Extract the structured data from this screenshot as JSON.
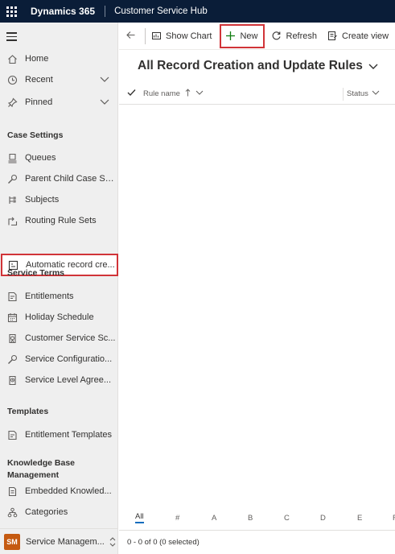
{
  "topbar": {
    "app_name": "Dynamics 365",
    "module_name": "Customer Service Hub"
  },
  "sidebar": {
    "top_items": [
      {
        "label": "Home",
        "icon": "home-icon"
      },
      {
        "label": "Recent",
        "icon": "clock-icon",
        "expandable": true
      },
      {
        "label": "Pinned",
        "icon": "pin-icon",
        "expandable": true
      }
    ],
    "sections": [
      {
        "title": "Case Settings",
        "items": [
          {
            "label": "Queues",
            "icon": "queue-icon"
          },
          {
            "label": "Parent Child Case Set...",
            "icon": "wrench-icon"
          },
          {
            "label": "Subjects",
            "icon": "subjects-icon"
          },
          {
            "label": "Routing Rule Sets",
            "icon": "routing-icon"
          },
          {
            "label": "Automatic record cre...",
            "icon": "record-creation-icon",
            "selected": true
          }
        ]
      },
      {
        "title": "Service Terms",
        "items": [
          {
            "label": "Entitlements",
            "icon": "entitlement-icon"
          },
          {
            "label": "Holiday Schedule",
            "icon": "calendar-icon"
          },
          {
            "label": "Customer Service Sc...",
            "icon": "schedule-icon"
          },
          {
            "label": "Service Configuratio...",
            "icon": "wrench-icon"
          },
          {
            "label": "Service Level Agree...",
            "icon": "sla-icon"
          }
        ]
      },
      {
        "title": "Templates",
        "items": [
          {
            "label": "Entitlement Templates",
            "icon": "entitlement-icon"
          }
        ]
      },
      {
        "title": "Knowledge Base Management",
        "items": [
          {
            "label": "Embedded Knowled...",
            "icon": "document-icon"
          },
          {
            "label": "Categories",
            "icon": "categories-icon"
          }
        ]
      }
    ],
    "area": {
      "badge": "SM",
      "label": "Service Managem...",
      "badge_color": "#c55a11"
    }
  },
  "commandbar": {
    "show_chart": "Show Chart",
    "new": "New",
    "refresh": "Refresh",
    "create_view": "Create view"
  },
  "view": {
    "title": "All Record Creation and Update Rules",
    "columns": {
      "rule_name": "Rule name",
      "status": "Status"
    }
  },
  "jumpbar": [
    "All",
    "#",
    "A",
    "B",
    "C",
    "D",
    "E",
    "F"
  ],
  "footer": {
    "count_text": "0 - 0 of 0 (0 selected)"
  },
  "colors": {
    "topbar": "#0a1d38",
    "highlight": "#d13438",
    "accent": "#0f6cbd",
    "sidebar": "#efefef"
  }
}
